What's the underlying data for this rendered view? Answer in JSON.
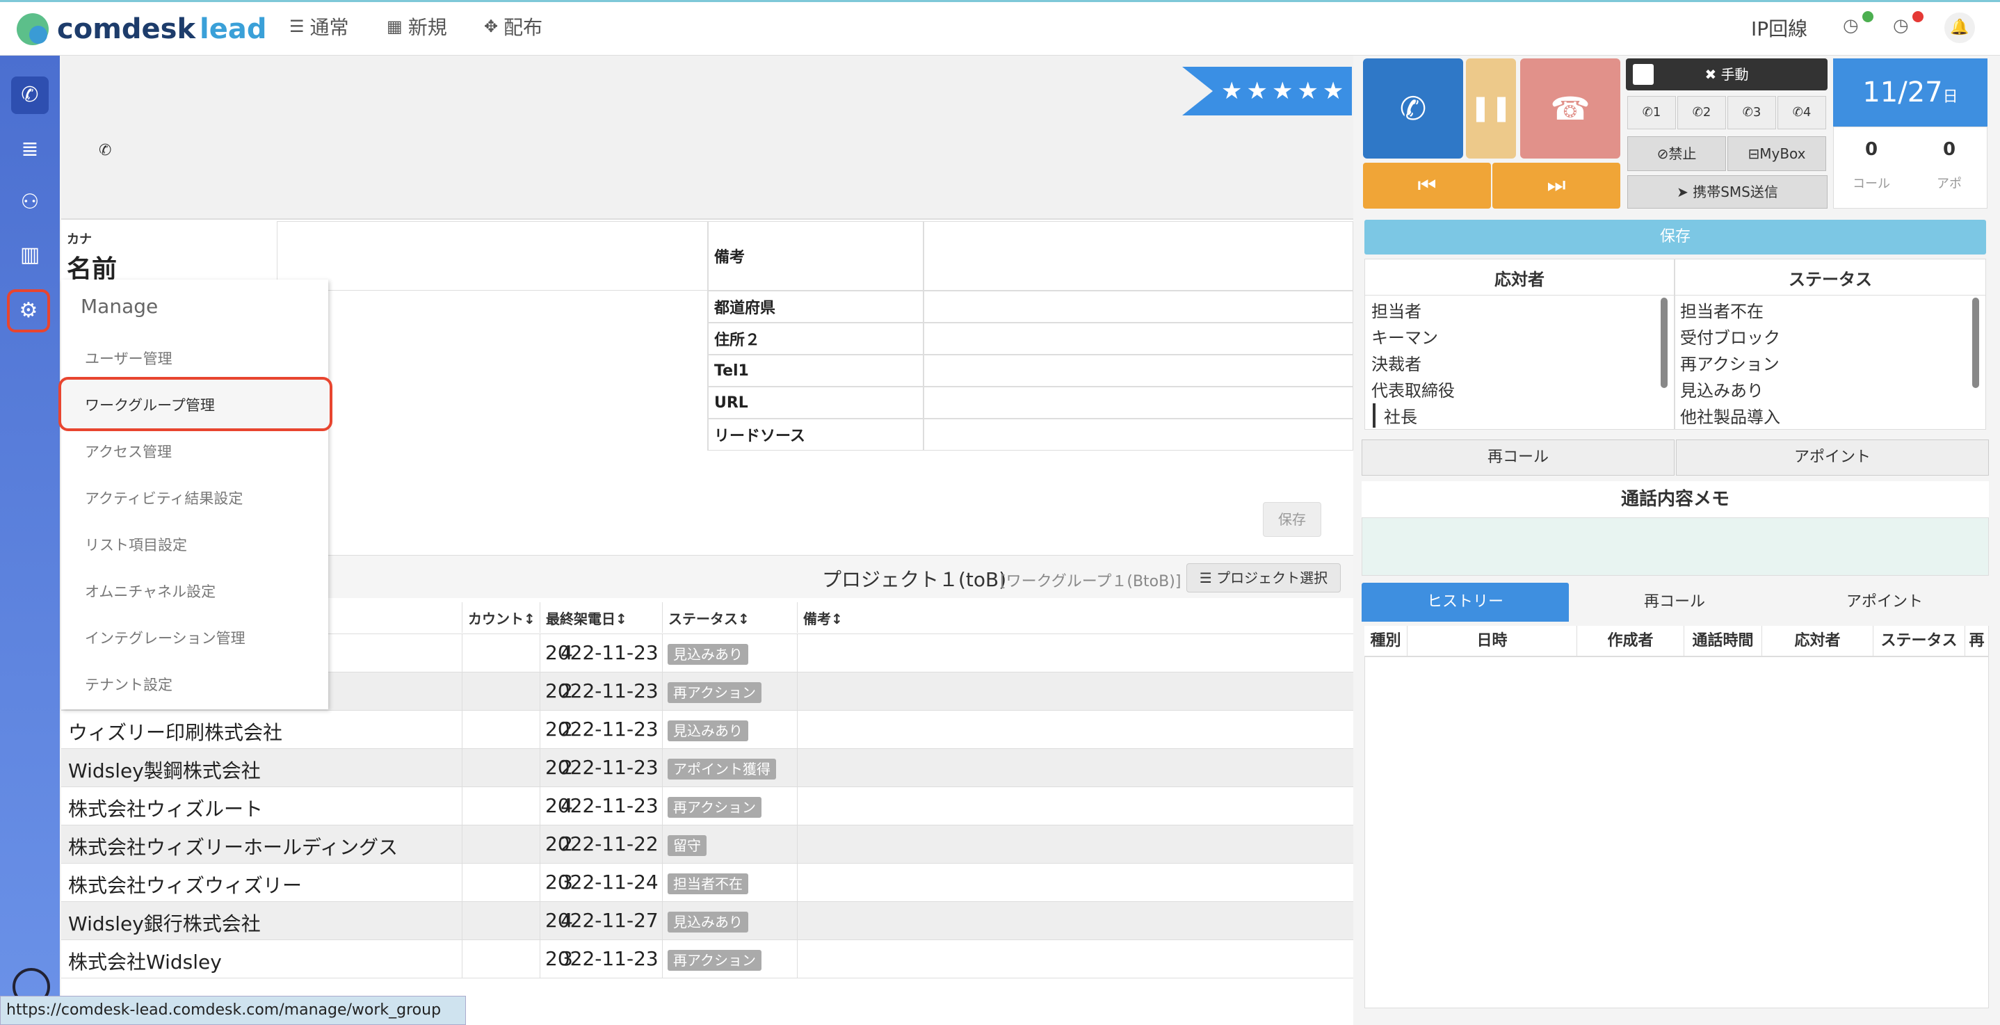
{
  "topbar": {
    "logo_main": "comdesk",
    "logo_accent": "lead",
    "nav": [
      {
        "icon": "list-icon",
        "glyph": "☰",
        "label": "通常"
      },
      {
        "icon": "grid-icon",
        "glyph": "▦",
        "label": "新規"
      },
      {
        "icon": "expand-icon",
        "glyph": "✥",
        "label": "配布"
      }
    ],
    "ip_line": "IP回線"
  },
  "header": {
    "stars": "★★★★★"
  },
  "record": {
    "kana_label": "カナ",
    "name_label": "名前",
    "fields": [
      "備考",
      "都道府県",
      "住所２",
      "Tel1",
      "URL",
      "リードソース"
    ],
    "save_label": "保存"
  },
  "project": {
    "title": "プロジェクト１(toB)",
    "workgroup": "[ワークグループ１(BtoB)]",
    "select_label": "プロジェクト選択"
  },
  "table": {
    "headers": [
      "カウント↕",
      "最終架電日↕",
      "ステータス↕",
      "備考↕"
    ],
    "rows": [
      {
        "name": "",
        "count": "4",
        "date": "2022-11-23",
        "status": "見込みあり"
      },
      {
        "name": "",
        "count": "2",
        "date": "2022-11-23",
        "status": "再アクション"
      },
      {
        "name": "ウィズリー印刷株式会社",
        "count": "2",
        "date": "2022-11-23",
        "status": "見込みあり"
      },
      {
        "name": "Widsley製鋼株式会社",
        "count": "2",
        "date": "2022-11-23",
        "status": "アポイント獲得"
      },
      {
        "name": "株式会社ウィズルート",
        "count": "4",
        "date": "2022-11-23",
        "status": "再アクション"
      },
      {
        "name": "株式会社ウィズリーホールディングス",
        "count": "2",
        "date": "2022-11-22",
        "status": "留守"
      },
      {
        "name": "株式会社ウィズウィズリー",
        "count": "3",
        "date": "2022-11-24",
        "status": "担当者不在"
      },
      {
        "name": "Widsley銀行株式会社",
        "count": "4",
        "date": "2022-11-27",
        "status": "見込みあり"
      },
      {
        "name": "株式会社Widsley",
        "count": "3",
        "date": "2022-11-23",
        "status": "再アクション"
      }
    ]
  },
  "manage_menu": {
    "title": "Manage",
    "items": [
      "ユーザー管理",
      "ワークグループ管理",
      "アクセス管理",
      "アクティビティ結果設定",
      "リスト項目設定",
      "オムニチャネル設定",
      "インテグレーション管理",
      "テナント設定"
    ]
  },
  "phone": {
    "manual": "手動",
    "lines": [
      "1",
      "2",
      "3",
      "4"
    ],
    "kinshi": "⊘禁止",
    "mybox": "MyBox",
    "sms": "携帯SMS送信",
    "date": "11/27",
    "date_suffix": "日",
    "call_count": "0",
    "call_label": "コール",
    "apo_count": "0",
    "apo_label": "アポ",
    "save_label": "保存"
  },
  "responders": {
    "header": "応対者",
    "items": [
      "担当者",
      "キーマン",
      "決裁者",
      "代表取締役",
      "社長"
    ]
  },
  "statuses": {
    "header": "ステータス",
    "items": [
      "担当者不在",
      "受付ブロック",
      "再アクション",
      "見込みあり",
      "他社製品導入"
    ]
  },
  "actions": {
    "recall": "再コール",
    "appoint": "アポイント"
  },
  "memo": {
    "title": "通話内容メモ"
  },
  "history": {
    "tabs": [
      "ヒストリー",
      "再コール",
      "アポイント"
    ],
    "headers": [
      "種別",
      "日時",
      "作成者",
      "通話時間",
      "応対者",
      "ステータス",
      "再"
    ]
  },
  "status_bar": {
    "url": "https://comdesk-lead.comdesk.com/manage/work_group"
  },
  "colors": {
    "accent": "#3e8fe0",
    "sidebar": "#5a80dc",
    "highlight": "#e8452f"
  }
}
